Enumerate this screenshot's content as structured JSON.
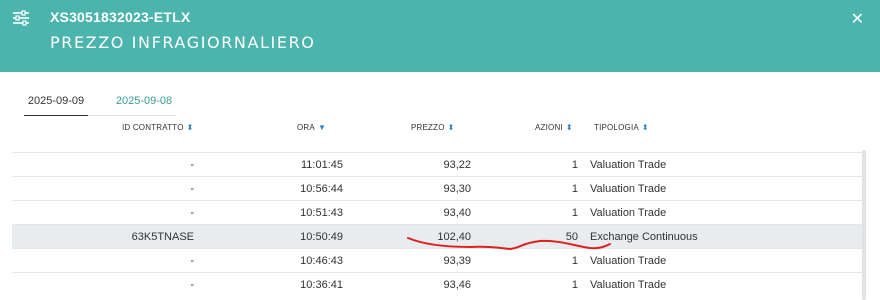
{
  "header": {
    "code": "XS3051832023-ETLX",
    "title": "PREZZO INFRAGIORNALIERO"
  },
  "tabs": [
    {
      "label": "2025-09-09",
      "active": true
    },
    {
      "label": "2025-09-08",
      "active": false
    }
  ],
  "columns": [
    "ID CONTRATTO",
    "ORA",
    "PREZZO",
    "AZIONI",
    "TIPOLOGIA"
  ],
  "rows": [
    {
      "id": "-",
      "ora": "11:01:45",
      "prezzo": "93,22",
      "azioni": "1",
      "tipologia": "Valuation Trade"
    },
    {
      "id": "-",
      "ora": "10:56:44",
      "prezzo": "93,30",
      "azioni": "1",
      "tipologia": "Valuation Trade"
    },
    {
      "id": "-",
      "ora": "10:51:43",
      "prezzo": "93,40",
      "azioni": "1",
      "tipologia": "Valuation Trade"
    },
    {
      "id": "63K5TNASE",
      "ora": "10:50:49",
      "prezzo": "102,40",
      "azioni": "50",
      "tipologia": "Exchange Continuous",
      "highlighted": true
    },
    {
      "id": "-",
      "ora": "10:46:43",
      "prezzo": "93,39",
      "azioni": "1",
      "tipologia": "Valuation Trade"
    },
    {
      "id": "-",
      "ora": "10:36:41",
      "prezzo": "93,46",
      "azioni": "1",
      "tipologia": "Valuation Trade"
    }
  ],
  "colors": {
    "header_bg": "#4bb4ac",
    "active_tab_text": "#333333",
    "inactive_tab_text": "#3a9d94",
    "sort_icon": "#2a83c9",
    "highlight_row": "#e8ecef",
    "annotation": "#e02020"
  },
  "icons": {
    "filter": "filter-sliders-icon",
    "close": "close-icon",
    "sort": "sort-updown-icon"
  }
}
